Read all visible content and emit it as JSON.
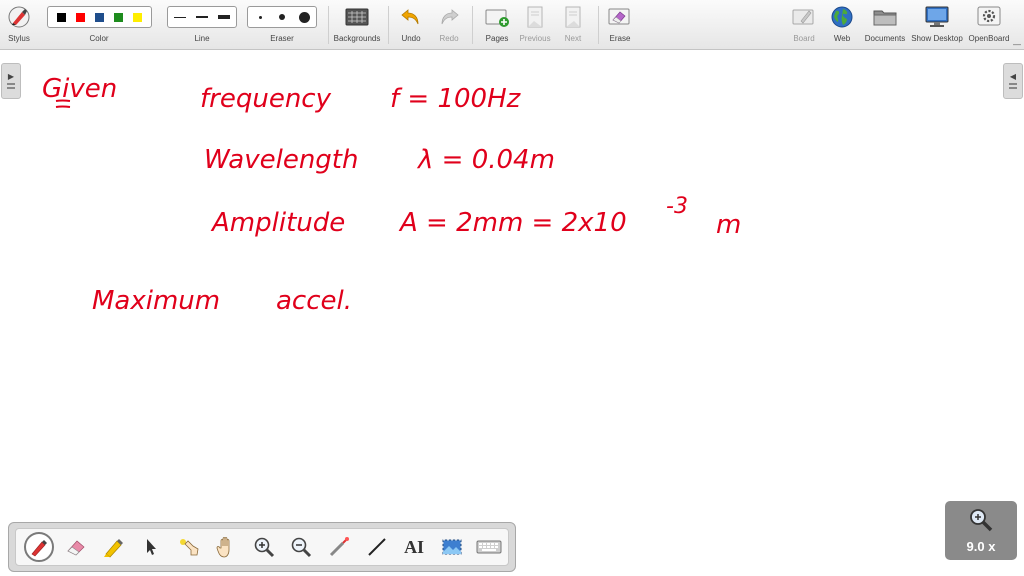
{
  "toolbar": {
    "stylus": "Stylus",
    "color": "Color",
    "line": "Line",
    "eraser": "Eraser",
    "backgrounds": "Backgrounds",
    "undo": "Undo",
    "redo": "Redo",
    "pages": "Pages",
    "previous": "Previous",
    "next": "Next",
    "erase": "Erase",
    "board": "Board",
    "web": "Web",
    "documents": "Documents",
    "show_desktop": "Show Desktop",
    "openboard": "OpenBoard"
  },
  "colors": {
    "swatches": [
      "#000000",
      "#ff0000",
      "#1f4e8c",
      "#1e8c1e",
      "#ffee00"
    ],
    "ink": "#e0001b",
    "accent": "#f0a400"
  },
  "handwriting": {
    "given": "Given",
    "frequency_label": "frequency",
    "frequency_value": "f = 100Hz",
    "wavelength_label": "Wavelength",
    "wavelength_value": "λ = 0.04m",
    "amplitude_label": "Amplitude",
    "amplitude_value": "A = 2mm = 2x10",
    "amplitude_exp": "-3",
    "amplitude_unit": "m",
    "max_label": "Maximum",
    "max_value": "accel."
  },
  "bottom_tools": {
    "ai_label": "AI"
  },
  "zoom": {
    "level": "9.0 x"
  }
}
